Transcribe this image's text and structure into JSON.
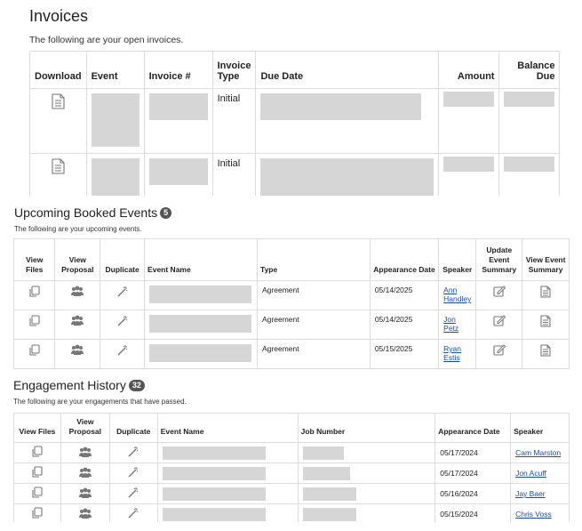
{
  "invoices": {
    "title": "Invoices",
    "subtitle": "The following are your open invoices.",
    "columns": [
      "Download",
      "Event",
      "Invoice #",
      "Invoice\nType",
      "Due Date",
      "Amount",
      "Balance\nDue"
    ],
    "rows": [
      {
        "download_icon": "document-icon",
        "type": "Initial"
      },
      {
        "download_icon": "document-icon",
        "type": "Initial"
      }
    ]
  },
  "upcoming": {
    "title": "Upcoming Booked Events",
    "count": "5",
    "subtitle": "The following are your upcoming events.",
    "columns": [
      "View\nFiles",
      "View\nProposal",
      "Duplicate",
      "Event Name",
      "Type",
      "Appearance Date",
      "Speaker",
      "Update\nEvent\nSummary",
      "View Event\nSummary"
    ],
    "rows": [
      {
        "type": "Agreement",
        "date": "05/14/2025",
        "speaker": "Ann\nHandley"
      },
      {
        "type": "Agreement",
        "date": "05/14/2025",
        "speaker": "Jon\nPetz"
      },
      {
        "type": "Agreement",
        "date": "05/15/2025",
        "speaker": "Ryan\nEstis"
      }
    ]
  },
  "history": {
    "title": "Engagement History",
    "count": "32",
    "subtitle": "The following are your engagements that have passed.",
    "columns": [
      "View Files",
      "View\nProposal",
      "Duplicate",
      "Event Name",
      "Job Number",
      "Appearance Date",
      "Speaker"
    ],
    "rows": [
      {
        "date": "05/17/2024",
        "speaker": "Cam Marston"
      },
      {
        "date": "05/17/2024",
        "speaker": "Jon Acuff"
      },
      {
        "date": "05/16/2024",
        "speaker": "Jay Baer"
      },
      {
        "date": "05/15/2024",
        "speaker": "Chris Voss"
      }
    ]
  },
  "icons": {
    "files": "files-copy-icon",
    "proposal": "people-group-icon",
    "duplicate": "magic-wand-icon",
    "update": "edit-pencil-icon",
    "view": "document-icon"
  }
}
